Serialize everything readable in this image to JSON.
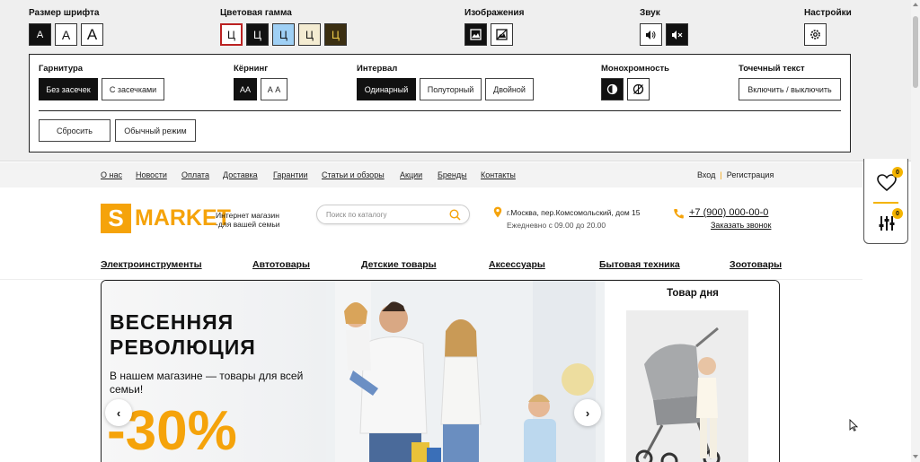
{
  "accessibility": {
    "font_size": {
      "label": "Размер шрифта",
      "buttons": [
        "A",
        "A",
        "A"
      ]
    },
    "color_scheme": {
      "label": "Цветовая гамма",
      "buttons": [
        "Ц",
        "Ц",
        "Ц",
        "Ц",
        "Ц"
      ],
      "colors": [
        "#ffffff",
        "#111111",
        "#9fd0f5",
        "#f4ecd2",
        "#3b2f12"
      ]
    },
    "images": {
      "label": "Изображения"
    },
    "sound": {
      "label": "Звук"
    },
    "settings": {
      "label": "Настройки"
    },
    "typeface": {
      "label": "Гарнитура",
      "options": [
        "Без засечек",
        "С засечками"
      ]
    },
    "kerning": {
      "label": "Кёрнинг",
      "options": [
        "АА",
        "А А"
      ]
    },
    "interval": {
      "label": "Интервал",
      "options": [
        "Одинарный",
        "Полуторный",
        "Двойной"
      ]
    },
    "monochrome": {
      "label": "Монохромность"
    },
    "dot_text": {
      "label": "Точечный текст",
      "button": "Включить / выключить"
    },
    "reset": "Сбросить",
    "normal_mode": "Обычный режим"
  },
  "topnav": {
    "links": [
      "О нас",
      "Новости",
      "Оплата",
      "Доставка",
      "Гарантии",
      "Статьи и обзоры",
      "Акции",
      "Бренды",
      "Контакты"
    ],
    "login": "Вход",
    "register": "Регистрация"
  },
  "floating": {
    "favorites_count": "0",
    "compare_count": "0"
  },
  "header": {
    "logo_letter": "S",
    "logo_text": "MARKET",
    "tagline_1": "Интернет магазин",
    "tagline_2": "-для вашей семьи",
    "search_placeholder": "Поиск по каталогу",
    "address": "г.Москва, пер.Комсомольский, дом 15",
    "hours": "Ежедневно с 09.00 до 20.00",
    "phone": "+7 (900) 000-00-0",
    "callback": "Заказать звонок"
  },
  "categories": [
    "Электроинструменты",
    "Автотовары",
    "Детские товары",
    "Аксессуары",
    "Бытовая техника",
    "Зоотовары"
  ],
  "banner": {
    "title_1": "ВЕСЕННЯЯ",
    "title_2": "РЕВОЛЮЦИЯ",
    "subtitle": "В нашем магазине — товары для всей семьи!",
    "discount": "-30%",
    "prev": "‹",
    "next": "›"
  },
  "deal": {
    "title": "Товар дня"
  },
  "colors": {
    "accent": "#f5a30a",
    "badge": "#f4b400"
  }
}
